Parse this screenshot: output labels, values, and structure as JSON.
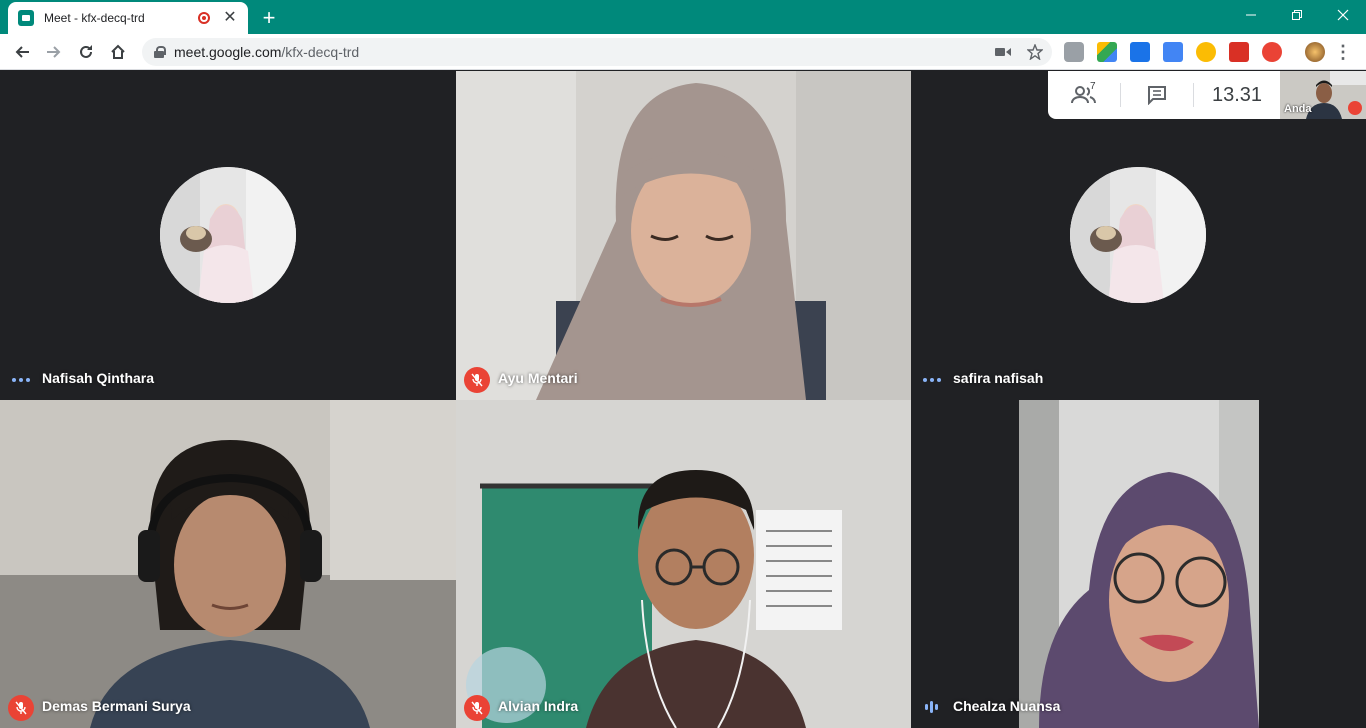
{
  "browser": {
    "tab_title": "Meet - kfx-decq-trd",
    "url_host": "meet.google.com",
    "url_path": "/kfx-decq-trd"
  },
  "meet": {
    "participant_count": "7",
    "clock": "13.31",
    "self_label": "Anda",
    "participants": [
      {
        "name": "Nafisah Qinthara",
        "audio": "active",
        "view": "avatar"
      },
      {
        "name": "Ayu Mentari",
        "audio": "muted",
        "view": "video"
      },
      {
        "name": "safira nafisah",
        "audio": "active",
        "view": "avatar"
      },
      {
        "name": "Demas Bermani Surya",
        "audio": "muted",
        "view": "video"
      },
      {
        "name": "Alvian Indra",
        "audio": "muted",
        "view": "video"
      },
      {
        "name": "Chealza Nuansa",
        "audio": "speaking",
        "view": "video"
      }
    ]
  },
  "colors": {
    "frame": "#00897b",
    "meet_background": "#202124",
    "muted_red": "#ea4335",
    "accent_blue": "#8ab4f8"
  },
  "icons": {
    "people": "people-icon",
    "chat": "chat-icon",
    "mic_off": "mic-off-icon",
    "audio": "audio-level-icon"
  }
}
